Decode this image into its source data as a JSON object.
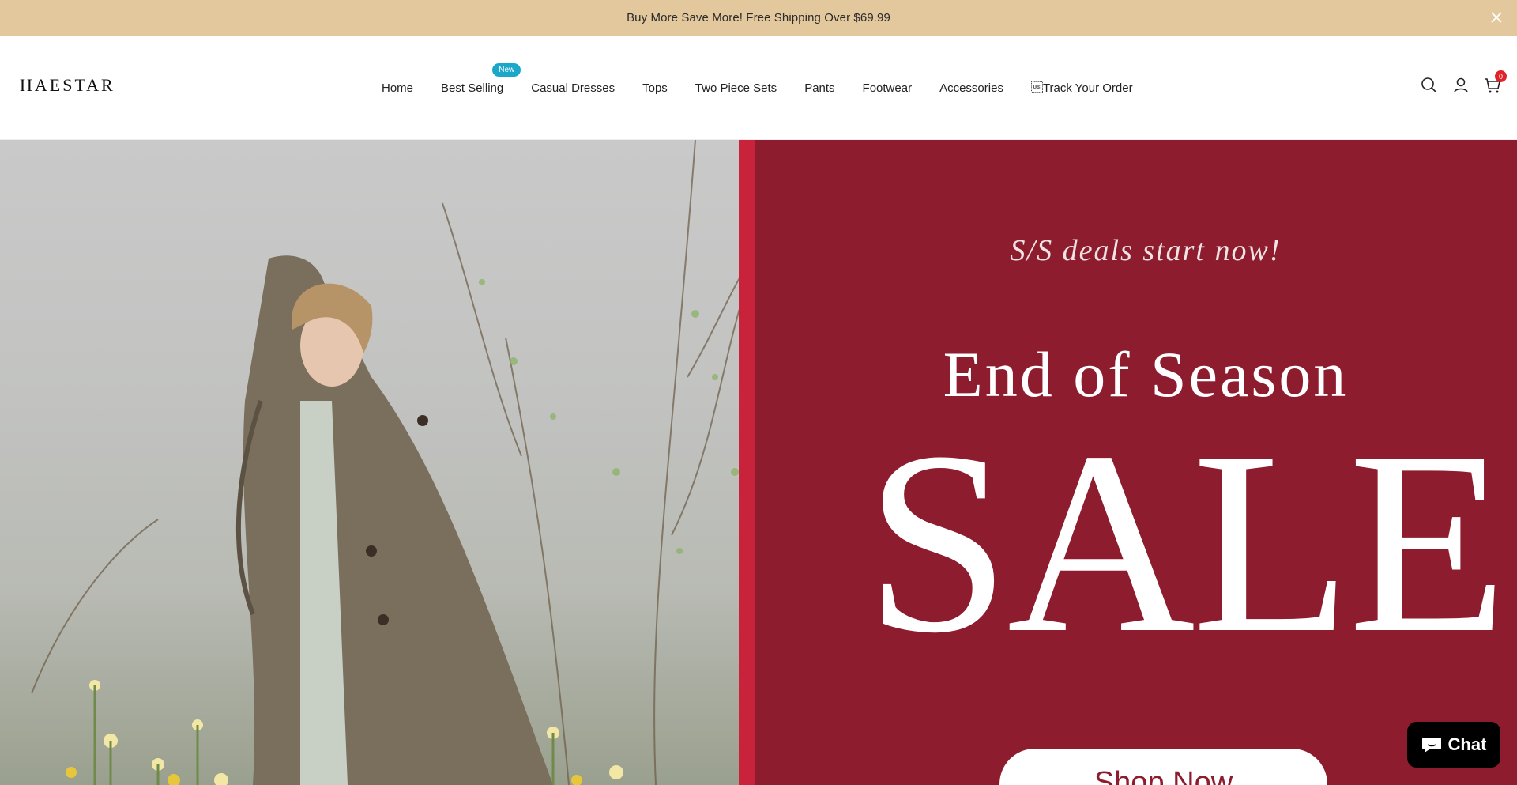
{
  "announcement": {
    "text": "Buy More Save More! Free Shipping Over $69.99",
    "close_icon": "close-icon"
  },
  "header": {
    "logo": "HAESTAR",
    "nav": [
      {
        "label": "Home"
      },
      {
        "label": "Best Selling",
        "badge": "New"
      },
      {
        "label": "Casual Dresses"
      },
      {
        "label": "Tops"
      },
      {
        "label": "Two Piece Sets"
      },
      {
        "label": "Pants"
      },
      {
        "label": "Footwear"
      },
      {
        "label": "Accessories"
      },
      {
        "label": "\u001fTrack Your Order"
      }
    ],
    "icons": [
      "search-icon",
      "account-icon",
      "cart-icon"
    ],
    "cart_count": "0"
  },
  "hero": {
    "subtitle": "S/S deals start now!",
    "title": "End of Season",
    "headline": "SALE",
    "cta": "Shop Now",
    "colors": {
      "background": "#8d1d2e",
      "band": "#c8233a",
      "text": "#ffffff"
    }
  },
  "chat": {
    "label": "Chat",
    "icon": "chat-bubble-icon"
  },
  "colors": {
    "announcement_bg": "#e3c89d",
    "badge": "#1aa7c9",
    "cart_badge": "#e0222a"
  }
}
